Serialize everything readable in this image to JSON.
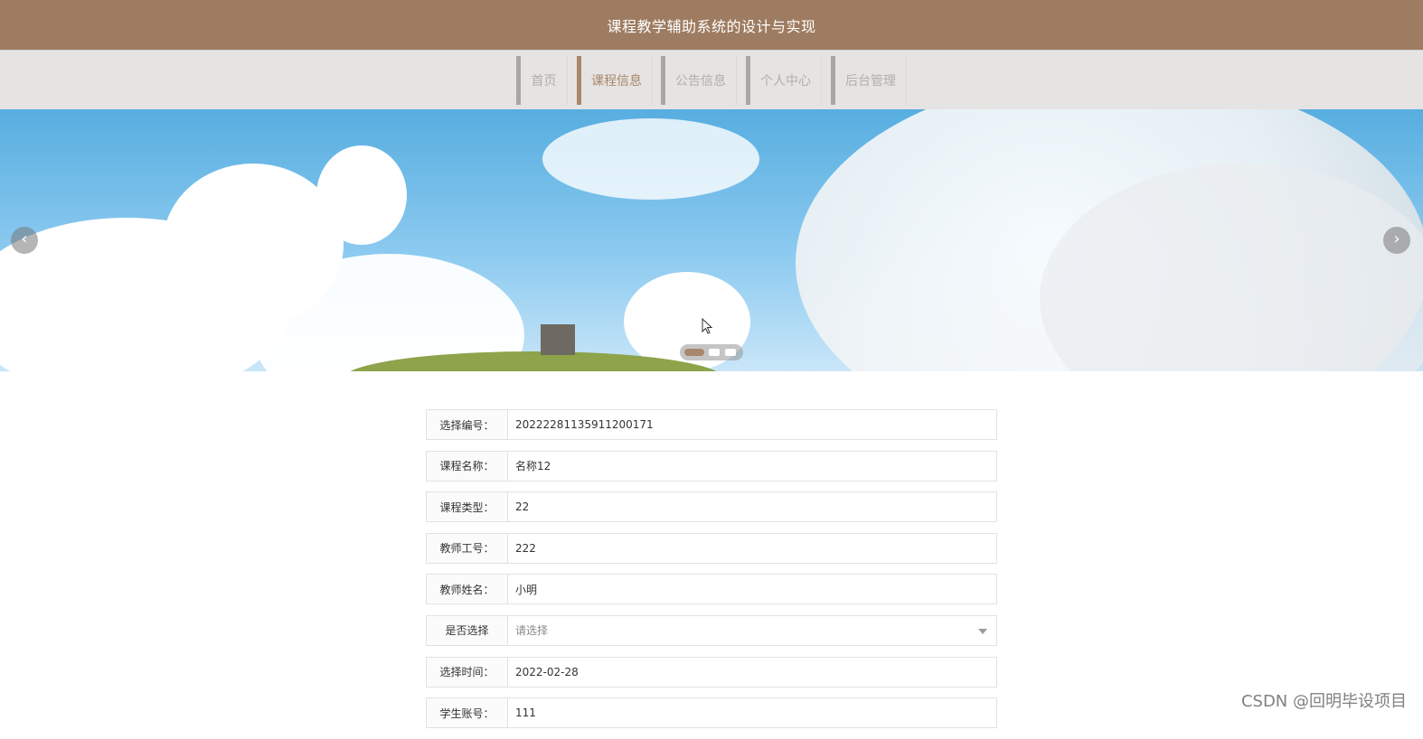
{
  "header": {
    "title": "课程教学辅助系统的设计与实现"
  },
  "nav": {
    "items": [
      {
        "label": "首页"
      },
      {
        "label": "课程信息"
      },
      {
        "label": "公告信息"
      },
      {
        "label": "个人中心"
      },
      {
        "label": "后台管理"
      }
    ],
    "active_index": 1,
    "colors": {
      "active": "#a8876a",
      "inactive": "#b2aeae",
      "bar": "#e6e3e3"
    }
  },
  "banner": {
    "prev_icon": "chevron-left-icon",
    "next_icon": "chevron-right-icon",
    "slide_count": 3,
    "active_slide": 0
  },
  "form": {
    "rows": [
      {
        "label": "选择编号：",
        "value": "20222281135911200171"
      },
      {
        "label": "课程名称：",
        "value": "名称12"
      },
      {
        "label": "课程类型：",
        "value": "22"
      },
      {
        "label": "教师工号：",
        "value": "222"
      },
      {
        "label": "教师姓名：",
        "value": "小明"
      },
      {
        "label": "是否选择",
        "value": "请选择",
        "is_select": true
      },
      {
        "label": "选择时间：",
        "value": "2022-02-28"
      },
      {
        "label": "学生账号：",
        "value": "111"
      }
    ]
  },
  "watermark": {
    "text": "CSDN @回明毕设项目"
  },
  "theme": {
    "header_bg": "#9e7c61",
    "accent": "#a8876a"
  }
}
